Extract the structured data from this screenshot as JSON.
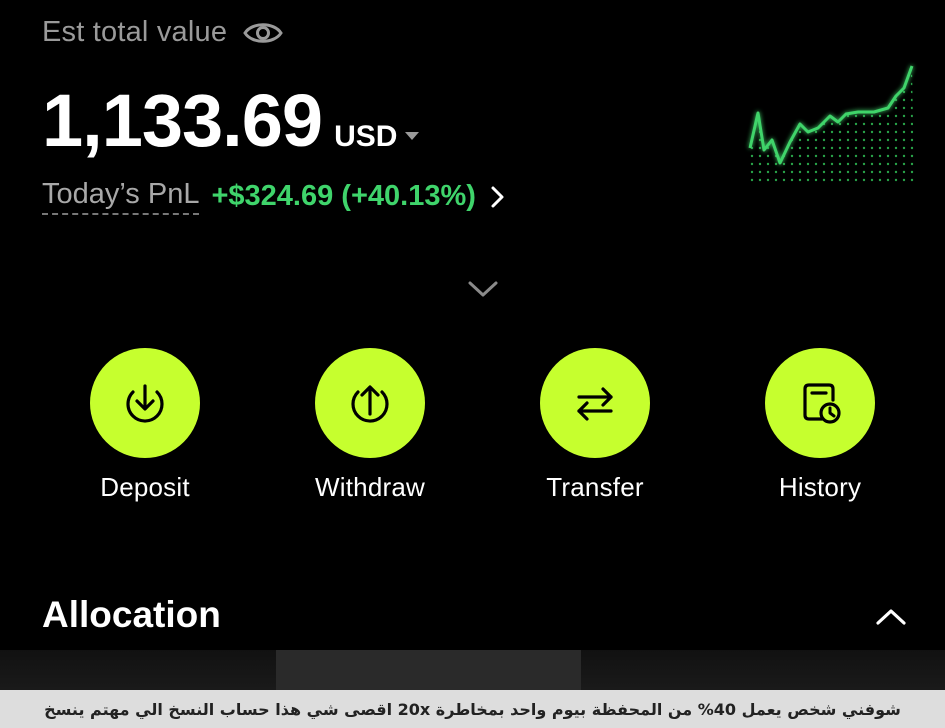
{
  "header": {
    "est_label": "Est total value",
    "value_amount": "1,133.69",
    "currency": "USD",
    "pnl_label": "Today’s PnL",
    "pnl_value": "+$324.69 (+40.13%)"
  },
  "icons": {
    "eye": "eye-icon",
    "currency_caret": "caret-down-icon",
    "pnl_chevron": "chevron-right-icon",
    "expand": "chevron-down-icon",
    "collapse": "chevron-up-icon"
  },
  "sparkline": {
    "color": "#3fd46b",
    "trend": "up"
  },
  "actions": [
    {
      "label": "Deposit",
      "icon": "deposit-icon"
    },
    {
      "label": "Withdraw",
      "icon": "withdraw-icon"
    },
    {
      "label": "Transfer",
      "icon": "transfer-icon"
    },
    {
      "label": "History",
      "icon": "history-icon"
    }
  ],
  "allocation": {
    "title": "Allocation"
  },
  "caption": {
    "text": "شوفني شخص يعمل 40% من المحفظة بيوم واحد بمخاطرة 20x اقصى شي هذا حساب النسخ الي مهتم ينسخ"
  },
  "colors": {
    "background": "#000000",
    "accent": "#c6ff2e",
    "positive": "#3fd46b",
    "muted": "#9a9a9a"
  }
}
